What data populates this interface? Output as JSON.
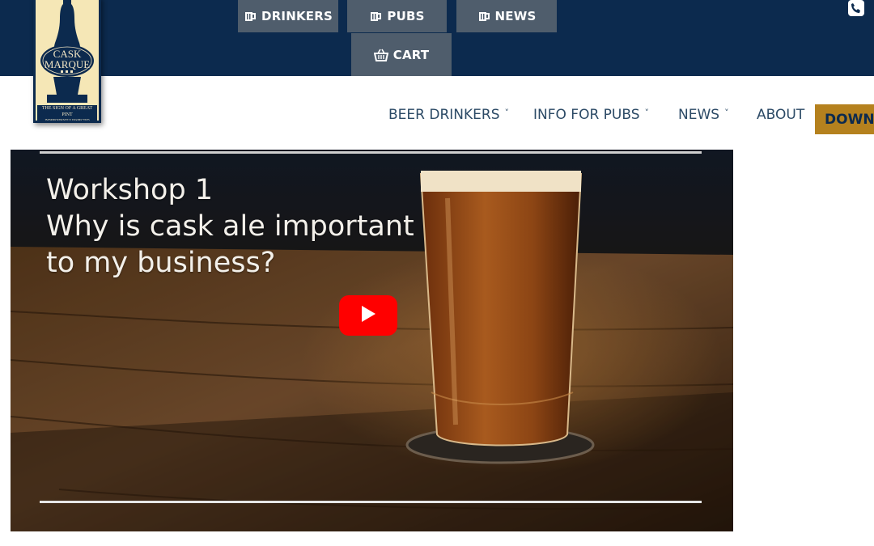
{
  "header": {
    "top_buttons": [
      {
        "label": "DRINKERS",
        "icon": "beer-mug-icon"
      },
      {
        "label": "PUBS",
        "icon": "beer-mug-icon"
      },
      {
        "label": "NEWS",
        "icon": "beer-mug-icon"
      }
    ],
    "cart": {
      "label": "CART",
      "icon": "basket-icon"
    },
    "phone_icon": "phone-icon",
    "colors": {
      "bar": "#0c2a4e",
      "button": "#4f5d6c",
      "accent": "#b5811e"
    }
  },
  "logo": {
    "line1": "CASK",
    "line2": "MARQUE",
    "tagline": "THE SIGN OF A GREAT PINT",
    "subtag": "INDEPENDENTLY INSPECTED"
  },
  "nav": {
    "items": [
      {
        "label": "BEER DRINKERS",
        "has_dropdown": true
      },
      {
        "label": "INFO FOR PUBS",
        "has_dropdown": true
      },
      {
        "label": "NEWS",
        "has_dropdown": true
      },
      {
        "label": "ABOUT",
        "has_dropdown": false
      }
    ],
    "download_label": "DOWN"
  },
  "video": {
    "title_line1": "Workshop 1",
    "title_line2": "Why is cask ale important",
    "title_line3": "to my business?",
    "play_icon": "youtube-play-icon"
  }
}
